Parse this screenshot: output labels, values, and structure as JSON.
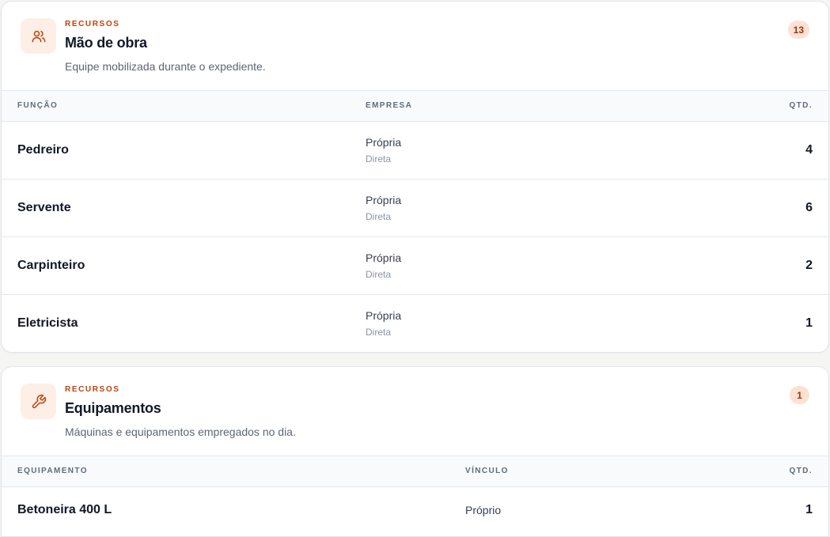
{
  "labor": {
    "eyebrow": "RECURSOS",
    "title": "Mão de obra",
    "subtitle": "Equipe mobilizada durante o expediente.",
    "count": "13",
    "icon": "users-icon",
    "columns": {
      "role": "FUNÇÃO",
      "company": "EMPRESA",
      "qty": "QTD."
    },
    "rows": [
      {
        "role": "Pedreiro",
        "company": "Própria",
        "type": "Direta",
        "qty": "4"
      },
      {
        "role": "Servente",
        "company": "Própria",
        "type": "Direta",
        "qty": "6"
      },
      {
        "role": "Carpinteiro",
        "company": "Própria",
        "type": "Direta",
        "qty": "2"
      },
      {
        "role": "Eletricista",
        "company": "Própria",
        "type": "Direta",
        "qty": "1"
      }
    ]
  },
  "equipment": {
    "eyebrow": "RECURSOS",
    "title": "Equipamentos",
    "subtitle": "Máquinas e equipamentos empregados no dia.",
    "count": "1",
    "icon": "wrench-icon",
    "columns": {
      "item": "EQUIPAMENTO",
      "link": "VÍNCULO",
      "qty": "QTD."
    },
    "rows": [
      {
        "item": "Betoneira 400 L",
        "link": "Próprio",
        "qty": "1"
      }
    ]
  },
  "colors": {
    "accent": "#c2410c",
    "accent_bg": "#fdeee6",
    "badge_bg": "#fde1d3",
    "icon_stroke": "#c2410c"
  }
}
